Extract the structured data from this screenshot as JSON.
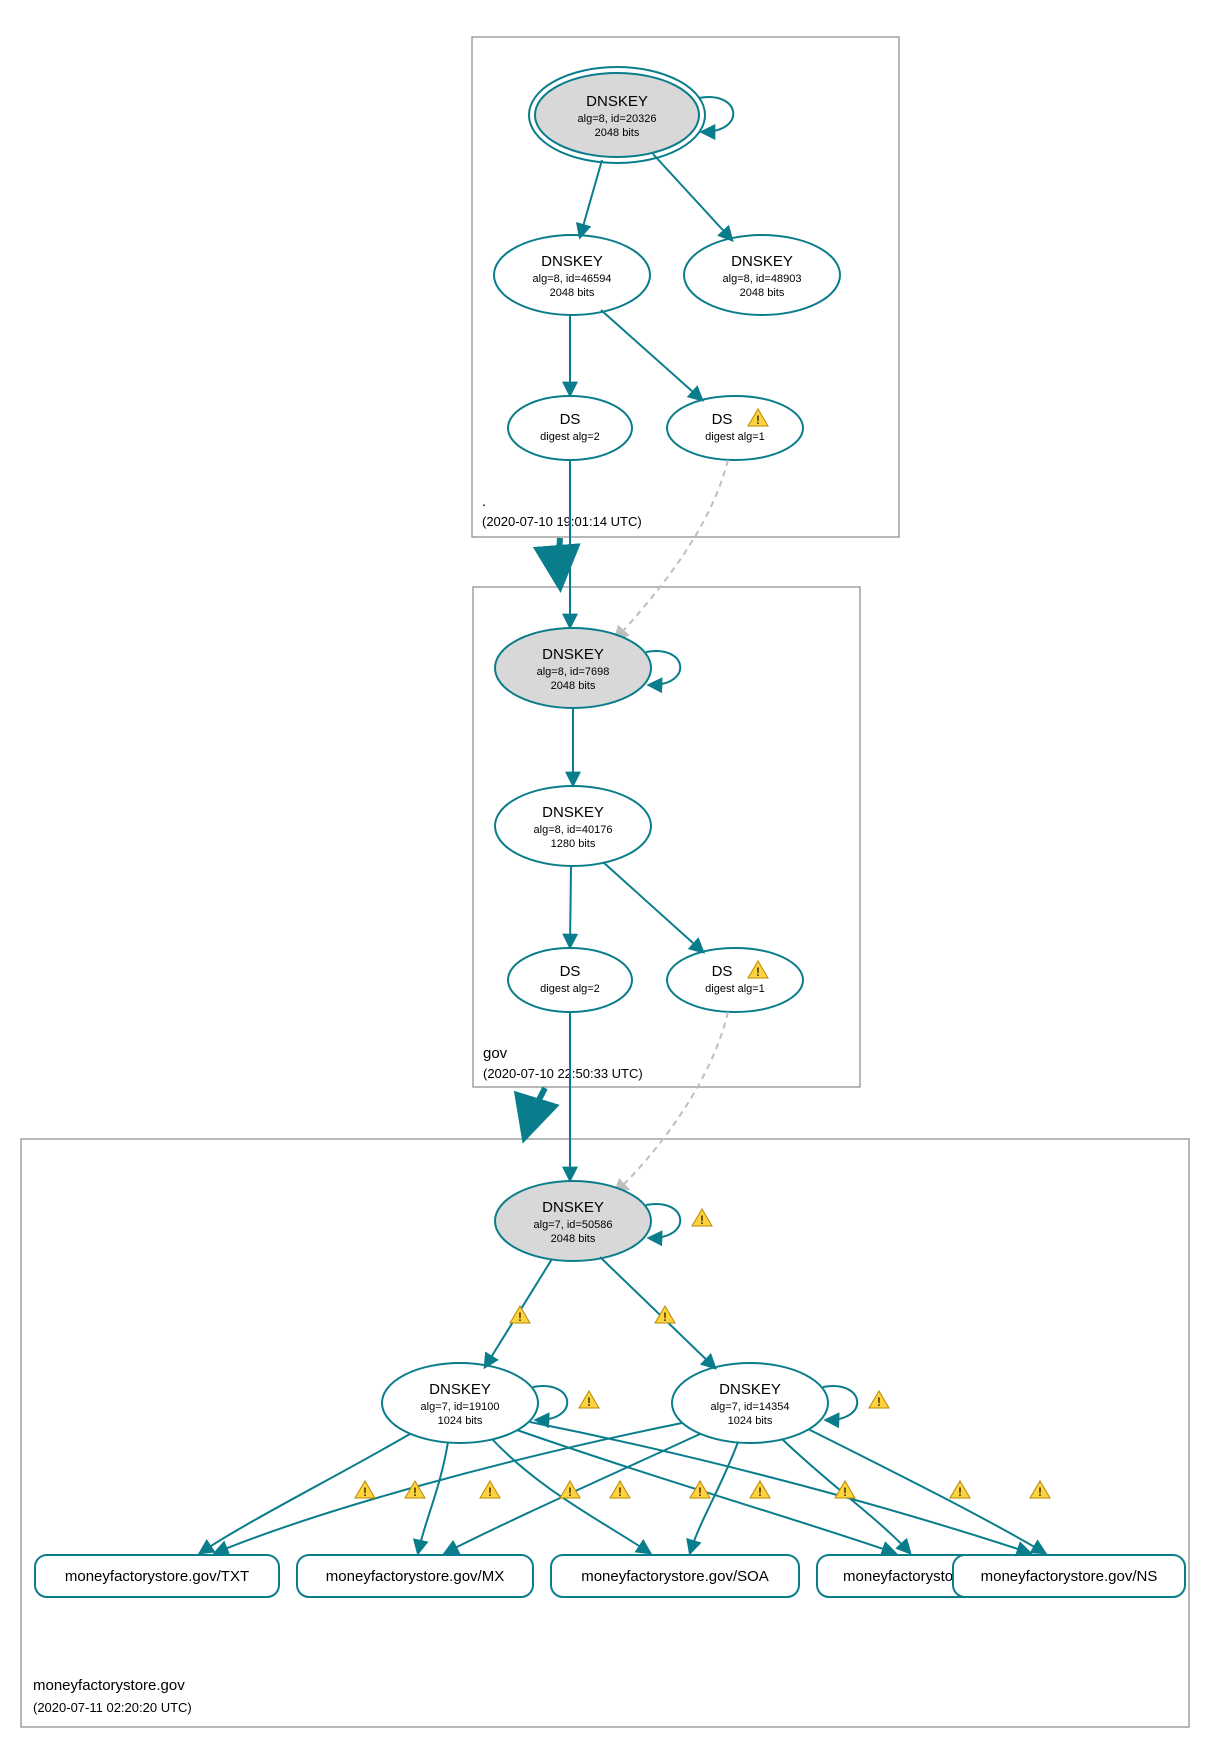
{
  "zones": {
    "root": {
      "title": ".",
      "timestamp": "(2020-07-10 19:01:14 UTC)"
    },
    "gov": {
      "title": "gov",
      "timestamp": "(2020-07-10 22:50:33 UTC)"
    },
    "mfs": {
      "title": "moneyfactorystore.gov",
      "timestamp": "(2020-07-11 02:20:20 UTC)"
    }
  },
  "nodes": {
    "root_ksk": {
      "l1": "DNSKEY",
      "l2": "alg=8, id=20326",
      "l3": "2048 bits"
    },
    "root_zsk1": {
      "l1": "DNSKEY",
      "l2": "alg=8, id=46594",
      "l3": "2048 bits"
    },
    "root_zsk2": {
      "l1": "DNSKEY",
      "l2": "alg=8, id=48903",
      "l3": "2048 bits"
    },
    "root_ds2": {
      "l1": "DS",
      "l2": "digest alg=2"
    },
    "root_ds1": {
      "l1": "DS",
      "l2": "digest alg=1"
    },
    "gov_ksk": {
      "l1": "DNSKEY",
      "l2": "alg=8, id=7698",
      "l3": "2048 bits"
    },
    "gov_zsk": {
      "l1": "DNSKEY",
      "l2": "alg=8, id=40176",
      "l3": "1280 bits"
    },
    "gov_ds2": {
      "l1": "DS",
      "l2": "digest alg=2"
    },
    "gov_ds1": {
      "l1": "DS",
      "l2": "digest alg=1"
    },
    "mfs_ksk": {
      "l1": "DNSKEY",
      "l2": "alg=7, id=50586",
      "l3": "2048 bits"
    },
    "mfs_zsk1": {
      "l1": "DNSKEY",
      "l2": "alg=7, id=19100",
      "l3": "1024 bits"
    },
    "mfs_zsk2": {
      "l1": "DNSKEY",
      "l2": "alg=7, id=14354",
      "l3": "1024 bits"
    },
    "rr_txt": "moneyfactorystore.gov/TXT",
    "rr_mx": "moneyfactorystore.gov/MX",
    "rr_soa": "moneyfactorystore.gov/SOA",
    "rr_a": "moneyfactorystore.gov/A",
    "rr_ns": "moneyfactorystore.gov/NS"
  },
  "colors": {
    "stroke": "#0a7d8c",
    "warn": "#ffd23f"
  }
}
